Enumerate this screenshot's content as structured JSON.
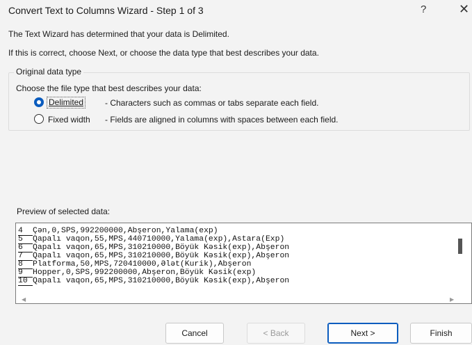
{
  "window": {
    "title": "Convert Text to Columns Wizard - Step 1 of 3",
    "help_label": "?",
    "close_label": "✕"
  },
  "intro": {
    "line1": "The Text Wizard has determined that your data is Delimited.",
    "line2": "If this is correct, choose Next, or choose the data type that best describes your data."
  },
  "original_data_type": {
    "legend": "Original data type",
    "prompt": "Choose the file type that best describes your data:",
    "options": [
      {
        "label": "Delimited",
        "description": "- Characters such as commas or tabs separate each field.",
        "selected": true
      },
      {
        "label": "Fixed width",
        "description": "- Fields are aligned in columns with spaces between each field.",
        "selected": false
      }
    ]
  },
  "preview": {
    "label": "Preview of selected data:",
    "rows": [
      {
        "num": "4",
        "text": "Çən,0,SPS,992200000,Abşeron,Yalama(exp)"
      },
      {
        "num": "5",
        "text": "Qapalı vaqon,55,MPS,440710000,Yalama(exp),Astara(Exp)"
      },
      {
        "num": "6",
        "text": "Qapalı vaqon,65,MPS,310210000,Böyük Kəsik(exp),Abşeron"
      },
      {
        "num": "7",
        "text": "Qapalı vaqon,65,MPS,310210000,Böyük Kəsik(exp),Abşeron"
      },
      {
        "num": "8",
        "text": "Platforma,50,MPS,720410000,Ələt(Kurik),Abşeron"
      },
      {
        "num": "9",
        "text": "Hopper,0,SPS,992200000,Abşeron,Böyük Kəsik(exp)"
      },
      {
        "num": "10",
        "text": "Qapalı vaqon,65,MPS,310210000,Böyük Kəsik(exp),Abşeron"
      }
    ]
  },
  "buttons": {
    "cancel": "Cancel",
    "back": "< Back",
    "next": "Next >",
    "finish": "Finish"
  },
  "colors": {
    "accent": "#0b5cbe",
    "background": "#f3f3f3"
  }
}
